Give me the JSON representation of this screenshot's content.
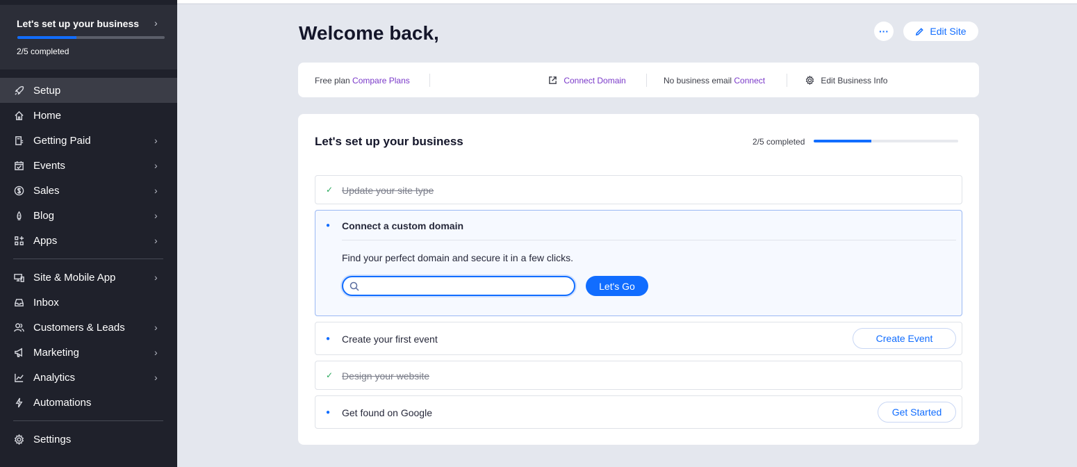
{
  "sidebar": {
    "setup_banner": {
      "title": "Let's set up your business",
      "progress_text": "2/5 completed",
      "progress": 0.4
    },
    "items": [
      {
        "label": "Setup",
        "icon": "rocket-icon",
        "chevron": false,
        "active": true
      },
      {
        "label": "Home",
        "icon": "home-icon",
        "chevron": false
      },
      {
        "label": "Getting Paid",
        "icon": "invoice-icon",
        "chevron": true
      },
      {
        "label": "Events",
        "icon": "calendar-icon",
        "chevron": true
      },
      {
        "label": "Sales",
        "icon": "dollar-icon",
        "chevron": true
      },
      {
        "label": "Blog",
        "icon": "pen-nib-icon",
        "chevron": true
      },
      {
        "label": "Apps",
        "icon": "apps-icon",
        "chevron": true
      },
      {
        "label": "Site & Mobile App",
        "icon": "devices-icon",
        "chevron": true
      },
      {
        "label": "Inbox",
        "icon": "inbox-icon",
        "chevron": false
      },
      {
        "label": "Customers & Leads",
        "icon": "people-icon",
        "chevron": true
      },
      {
        "label": "Marketing",
        "icon": "megaphone-icon",
        "chevron": true
      },
      {
        "label": "Analytics",
        "icon": "chart-icon",
        "chevron": true
      },
      {
        "label": "Automations",
        "icon": "lightning-icon",
        "chevron": false
      },
      {
        "label": "Settings",
        "icon": "gear-icon",
        "chevron": false
      }
    ]
  },
  "header": {
    "welcome": "Welcome back,",
    "more_label": "···",
    "edit_site_label": "Edit Site"
  },
  "info_bar": {
    "plan_text": "Free plan",
    "compare_plans": "Compare Plans",
    "connect_domain": "Connect Domain",
    "email_text": "No business email",
    "email_connect": "Connect",
    "edit_business_info": "Edit Business Info"
  },
  "setup": {
    "title": "Let's set up your business",
    "progress_text": "2/5 completed",
    "progress": 0.4,
    "tasks": [
      {
        "label": "Update your site type",
        "done": true
      },
      {
        "label": "Connect a custom domain",
        "done": false,
        "expanded": true,
        "description": "Find your perfect domain and secure it in a few clicks.",
        "search_placeholder": "",
        "search_value": "",
        "button": "Let's Go"
      },
      {
        "label": "Create your first event",
        "done": false,
        "button": "Create Event"
      },
      {
        "label": "Design your website",
        "done": true
      },
      {
        "label": "Get found on Google",
        "done": false,
        "button": "Get Started"
      }
    ]
  },
  "colors": {
    "accent": "#116dff",
    "link_purple": "#7a39c9",
    "sidebar_bg": "#1f212b",
    "check_green": "#27a85a"
  }
}
